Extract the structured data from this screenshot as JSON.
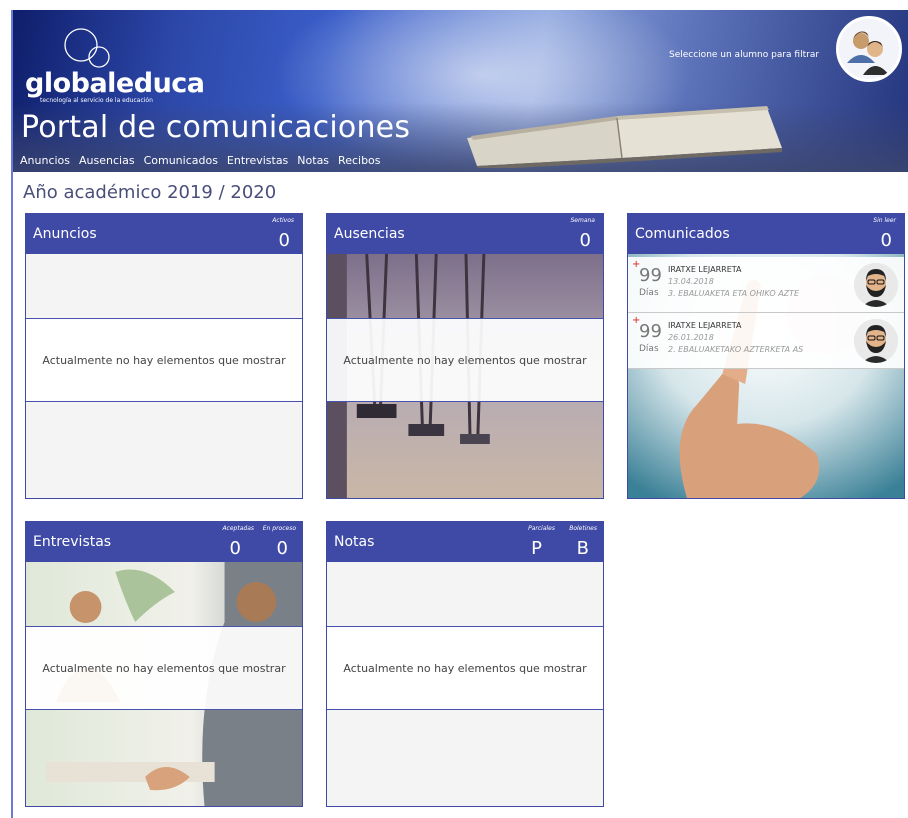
{
  "header": {
    "logo_name": "globaleduca",
    "logo_tagline": "tecnología al servicio de la educación",
    "portal_title": "Portal de comunicaciones",
    "filter_text": "Seleccione un alumno para filtrar",
    "nav": [
      "Anuncios",
      "Ausencias",
      "Comunicados",
      "Entrevistas",
      "Notas",
      "Recibos"
    ]
  },
  "academic_year": "Año académico 2019 / 2020",
  "empty_text": "Actualmente no hay elementos que mostrar",
  "cards": {
    "anuncios": {
      "title": "Anuncios",
      "counters": [
        {
          "label": "Activos",
          "value": "0"
        }
      ]
    },
    "ausencias": {
      "title": "Ausencias",
      "counters": [
        {
          "label": "Semana",
          "value": "0"
        }
      ]
    },
    "comunicados": {
      "title": "Comunicados",
      "counters": [
        {
          "label": "Sin leer",
          "value": "0"
        }
      ],
      "messages": [
        {
          "plus": "+",
          "days": "99",
          "days_label": "Días",
          "from": "IRATXE LEJARRETA",
          "date": "13.04.2018",
          "subject": "3. EBALUAKETA ETA OHIKO AZTE"
        },
        {
          "plus": "+",
          "days": "99",
          "days_label": "Días",
          "from": "IRATXE LEJARRETA",
          "date": "26.01.2018",
          "subject": "2. EBALUAKETAKO AZTERKETA AS"
        }
      ]
    },
    "entrevistas": {
      "title": "Entrevistas",
      "counters": [
        {
          "label": "Aceptadas",
          "value": "0"
        },
        {
          "label": "En proceso",
          "value": "0"
        }
      ]
    },
    "notas": {
      "title": "Notas",
      "counters": [
        {
          "label": "Parciales",
          "value": "P"
        },
        {
          "label": "Boletines",
          "value": "B"
        }
      ]
    }
  },
  "colors": {
    "primary": "#3f4aa6",
    "border": "#4752ad"
  }
}
